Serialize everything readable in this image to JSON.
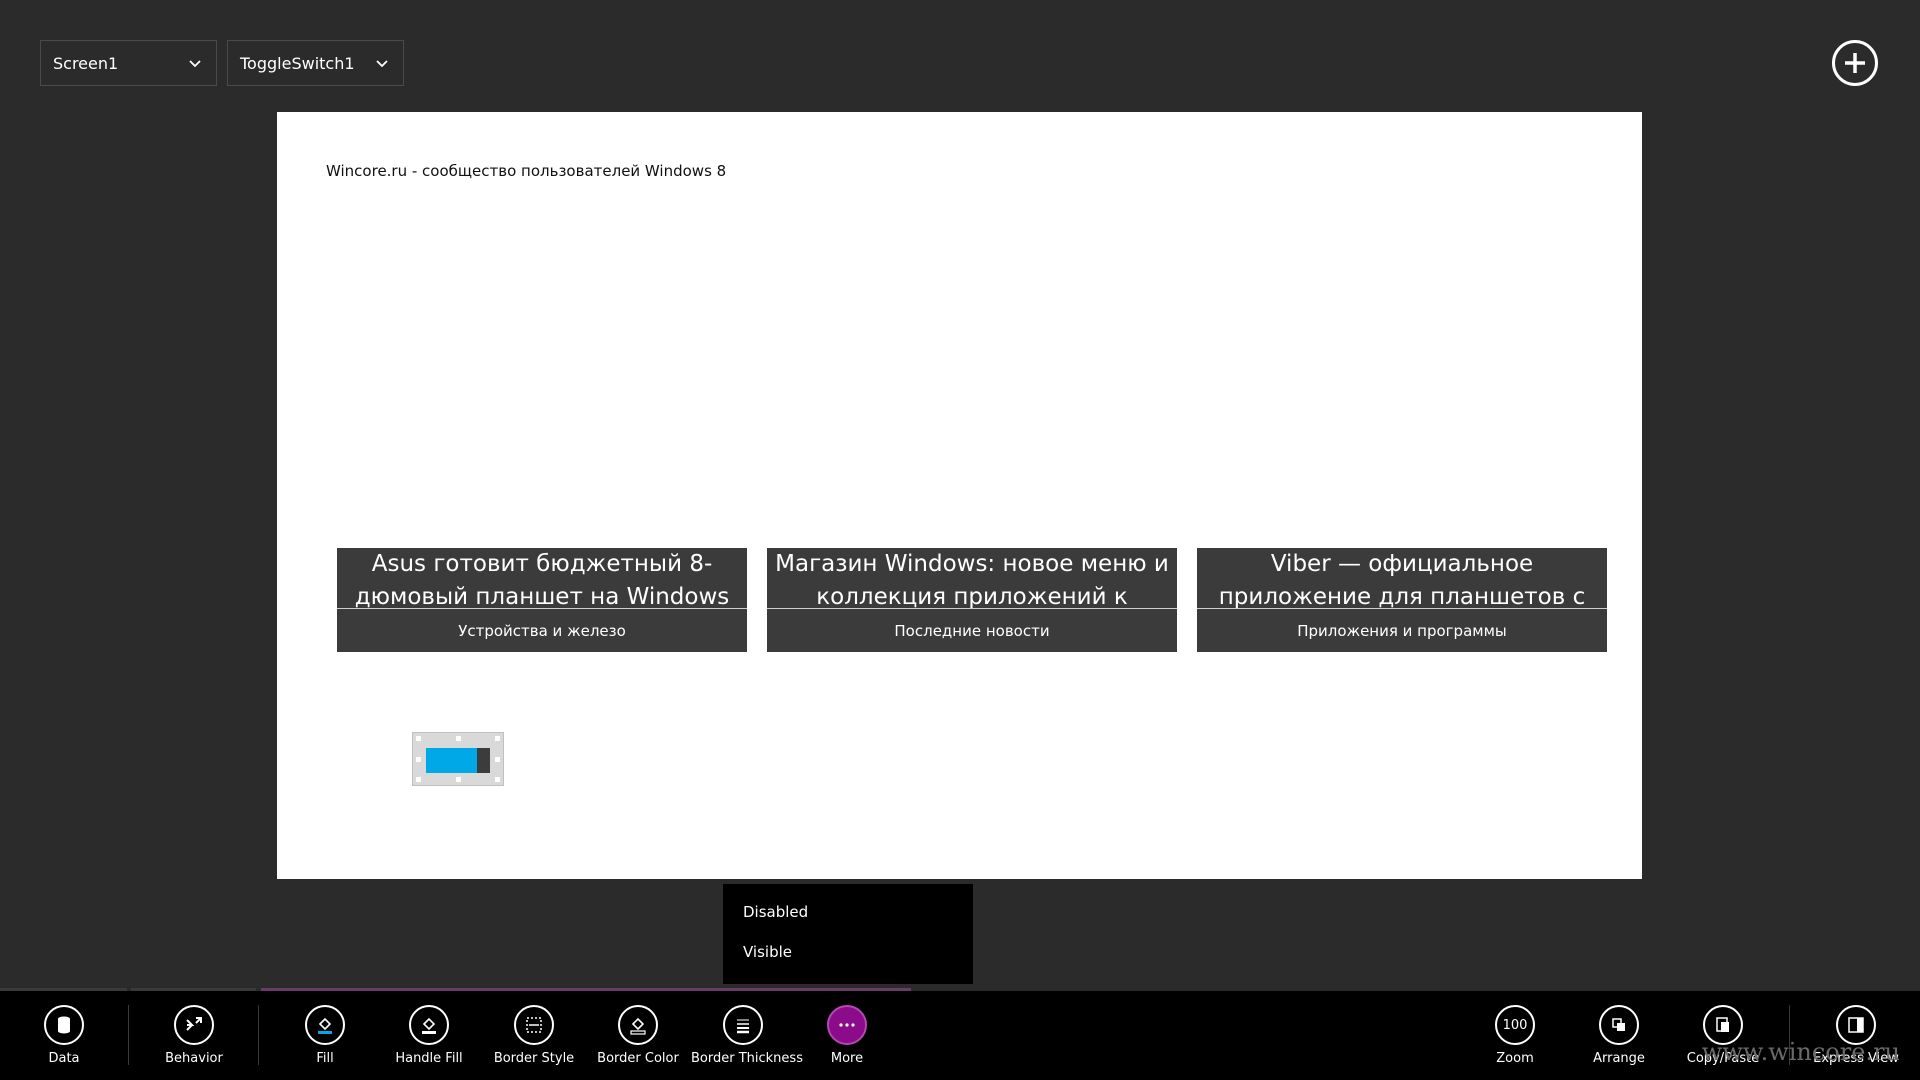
{
  "top": {
    "screen_dropdown": "Screen1",
    "control_dropdown": "ToggleSwitch1"
  },
  "canvas": {
    "title": "Wincore.ru - сообщество пользователей Windows 8",
    "tiles": [
      {
        "headline": "Asus готовит бюджетный 8-дюмовый планшет на Windows",
        "category": "Устройства и железо"
      },
      {
        "headline": "Магазин Windows: новое меню и коллекция приложений к",
        "category": "Последние новости"
      },
      {
        "headline": "Viber — официальное приложение для планшетов с",
        "category": "Приложения и программы"
      }
    ],
    "toggle": {
      "fill_fraction": 0.8,
      "on_color": "#00a8e8"
    }
  },
  "more_menu": {
    "items": [
      "Disabled",
      "Visible"
    ]
  },
  "appbar": {
    "left": [
      {
        "label": "Data",
        "icon": "database-icon"
      },
      {
        "label": "Behavior",
        "icon": "behavior-icon"
      }
    ],
    "middle": [
      {
        "label": "Fill",
        "icon": "fill-icon"
      },
      {
        "label": "Handle Fill",
        "icon": "handle-fill-icon"
      },
      {
        "label": "Border Style",
        "icon": "border-style-icon"
      },
      {
        "label": "Border Color",
        "icon": "border-color-icon"
      },
      {
        "label": "Border Thickness",
        "icon": "border-thickness-icon"
      },
      {
        "label": "More",
        "icon": "more-icon"
      }
    ],
    "right": [
      {
        "label": "Zoom",
        "icon": "zoom-icon",
        "value": "100"
      },
      {
        "label": "Arrange",
        "icon": "arrange-icon"
      },
      {
        "label": "Copy/Paste",
        "icon": "copy-paste-icon"
      },
      {
        "label": "Express View",
        "icon": "express-view-icon"
      }
    ]
  },
  "watermark": "www.wincore.ru",
  "colors": {
    "accent": "#8b0b8b",
    "toggle_on": "#00a8e8"
  }
}
